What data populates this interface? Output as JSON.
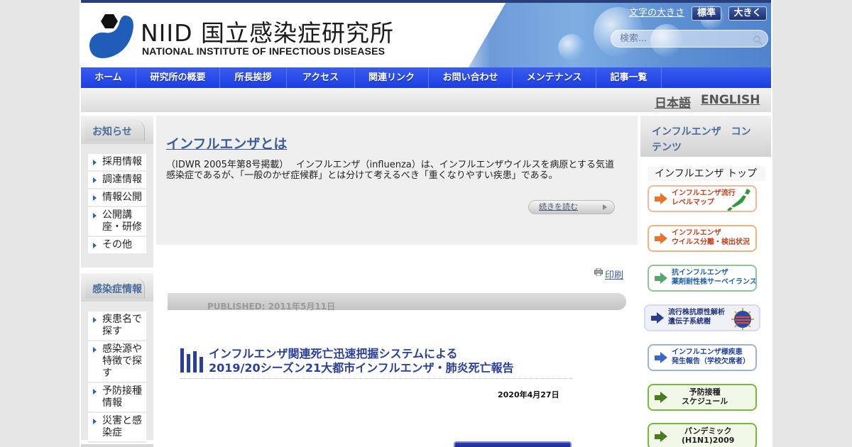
{
  "header": {
    "logo_title": "NIID 国立感染症研究所",
    "logo_subtitle": "NATIONAL INSTITUTE OF INFECTIOUS DISEASES",
    "font_size_label": "文字の大きさ",
    "font_size_standard": "標準",
    "font_size_large": "大きく",
    "search_placeholder": "検索..."
  },
  "nav": {
    "items": [
      "ホーム",
      "研究所の概要",
      "所長挨拶",
      "アクセス",
      "関連リンク",
      "お問い合わせ",
      "メンテナンス",
      "記事一覧"
    ]
  },
  "lang": {
    "japanese": "日本語",
    "english": "ENGLISH"
  },
  "sidebar_left": {
    "news_title": "お知らせ",
    "news_items": [
      "採用情報",
      "調達情報",
      "情報公開",
      "公開講座・研修",
      "その他"
    ],
    "disease_title": "感染症情報",
    "disease_items": [
      "疾患名で探す",
      "感染源や特徴で探す",
      "予防接種情報",
      "災害と感染症"
    ]
  },
  "article": {
    "title": "インフルエンザとは",
    "body": "（IDWR 2005年第8号掲載）　 インフルエンザ（influenza）は、インフルエンザウイルスを病原とする気道感染症であるが、「一般のかぜ症候群」とは分けて考えるべき「重くなりやすい疾患」である。",
    "read_more": "続きを読む"
  },
  "content": {
    "print": "印刷",
    "published": "PUBLISHED: 2011年5月11日",
    "report_title_line1": "インフルエンザ関連死亡迅速把握システムによる",
    "report_title_line2": "2019/20シーズン21大都市インフルエンザ・肺炎死亡報告",
    "report_date": "2020年4月27日"
  },
  "sidebar_right": {
    "title": "インフルエンザ　コンテンツ",
    "top_link": "インフルエンザ トップ",
    "banners": [
      {
        "line1": "インフルエンザ流行",
        "line2": "レベルマップ",
        "color": "#e8742a"
      },
      {
        "line1": "インフルエンザ",
        "line2": "ウイルス分離・検出状況",
        "color": "#e8742a"
      },
      {
        "line1": "抗インフルエンザ",
        "line2": "薬剤耐性株サーベイランス",
        "color": "#56a86a"
      },
      {
        "line1": "流行株抗原性解析",
        "line2": "遺伝子系統樹",
        "color": "#2a3f8a"
      },
      {
        "line1": "インフルエンザ様疾患",
        "line2": "発生報告（学校欠席者）",
        "color": "#3a66c4"
      },
      {
        "line1": "予防接種",
        "line2": "スケジュール",
        "color": "#4a7a22"
      },
      {
        "line1": "パンデミック",
        "line2": "(H1N1)2009",
        "color": "#4a7a22"
      }
    ]
  }
}
